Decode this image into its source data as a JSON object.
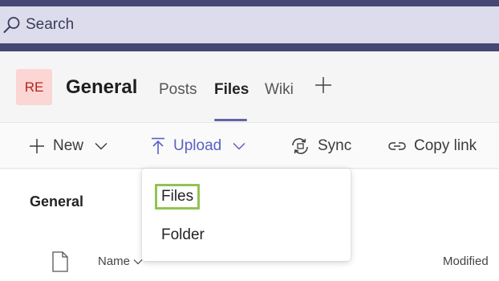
{
  "search": {
    "label": "Search"
  },
  "header": {
    "avatar_initials": "RE",
    "channel_title": "General",
    "tabs": [
      {
        "label": "Posts",
        "active": false
      },
      {
        "label": "Files",
        "active": true
      },
      {
        "label": "Wiki",
        "active": false
      }
    ]
  },
  "toolbar": {
    "new_label": "New",
    "upload_label": "Upload",
    "sync_label": "Sync",
    "copy_link_label": "Copy link"
  },
  "content": {
    "breadcrumb": "General",
    "columns": {
      "name": "Name",
      "modified": "Modified"
    }
  },
  "upload_menu": {
    "items": [
      {
        "label": "Files",
        "highlighted": true
      },
      {
        "label": "Folder",
        "highlighted": false
      }
    ]
  },
  "colors": {
    "accent": "#6264a7",
    "upload_active": "#5b5fc7",
    "highlight_border": "#92c353",
    "avatar_bg": "#fbd6d4",
    "avatar_text": "#b5221a",
    "top_band": "#464775"
  }
}
